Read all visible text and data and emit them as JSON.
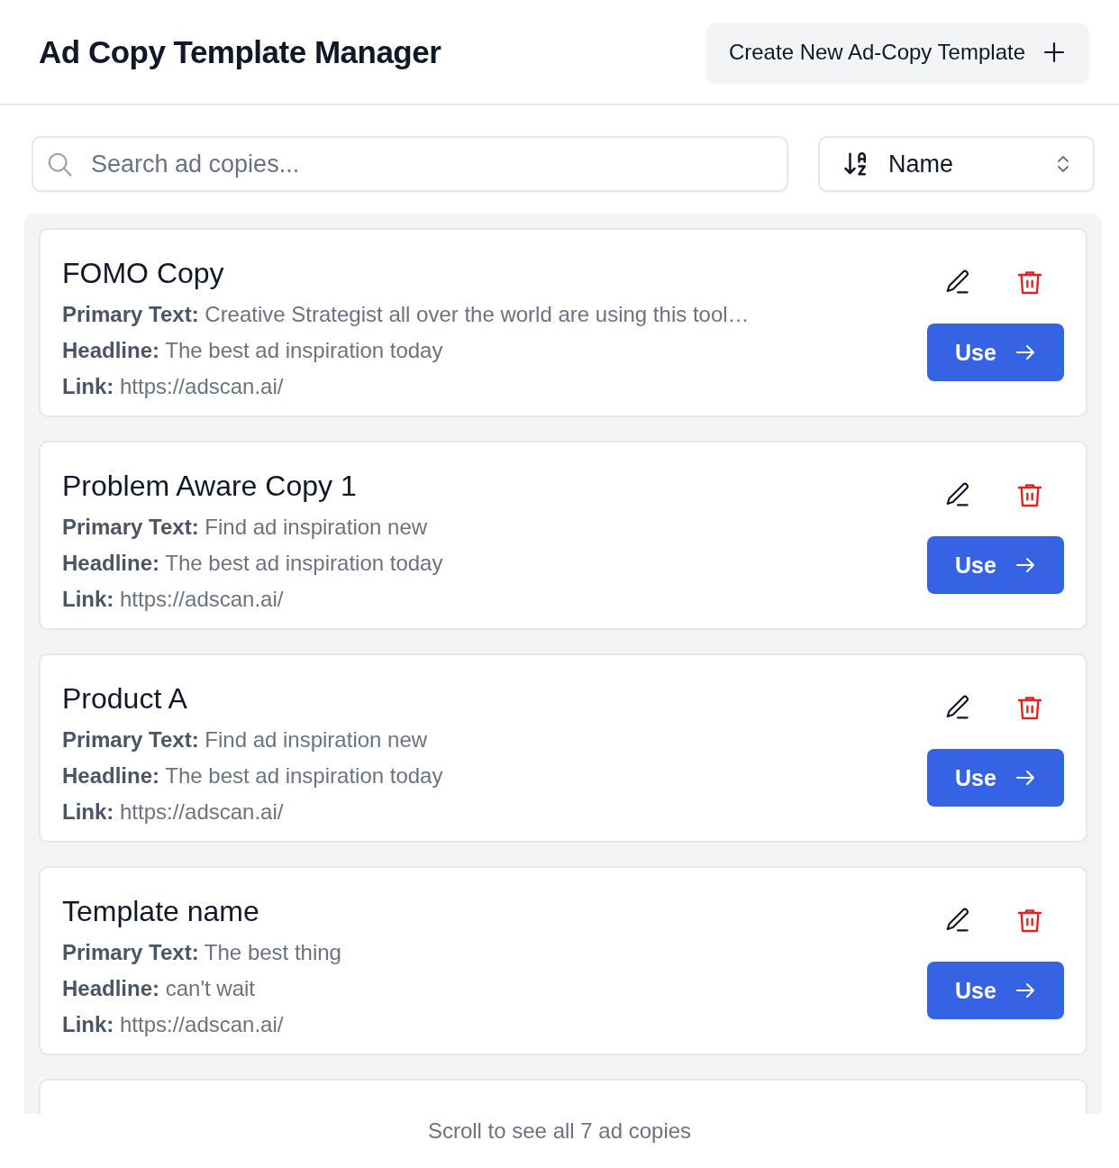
{
  "header": {
    "title": "Ad Copy Template Manager",
    "create_button": "Create New Ad-Copy Template"
  },
  "search": {
    "placeholder": "Search ad copies..."
  },
  "sort": {
    "value": "Name"
  },
  "templates": [
    {
      "name": "FOMO Copy",
      "lines": [
        "**Primary Text:** Creative Strategist all over the world are using this tool…",
        "**Headline:** The best ad inspiration today",
        "**Link:** https://adscan.ai/"
      ],
      "use": "Use"
    },
    {
      "name": "Problem Aware Copy 1",
      "lines": [
        "**Primary Text:** Find ad inspiration new",
        "**Headline:** The best ad inspiration today",
        "**Link:** https://adscan.ai/"
      ],
      "use": "Use"
    },
    {
      "name": "Product A",
      "lines": [
        "**Primary Text:** Find ad inspiration new",
        "**Headline:** The best ad inspiration today",
        "**Link:** https://adscan.ai/"
      ],
      "use": "Use"
    },
    {
      "name": "Template name",
      "lines": [
        "**Primary Text:** The best thing",
        "**Headline:** can't wait",
        "**Link:** https://adscan.ai/"
      ],
      "use": "Use"
    }
  ],
  "footer": "Scroll to see all 7 ad copies"
}
